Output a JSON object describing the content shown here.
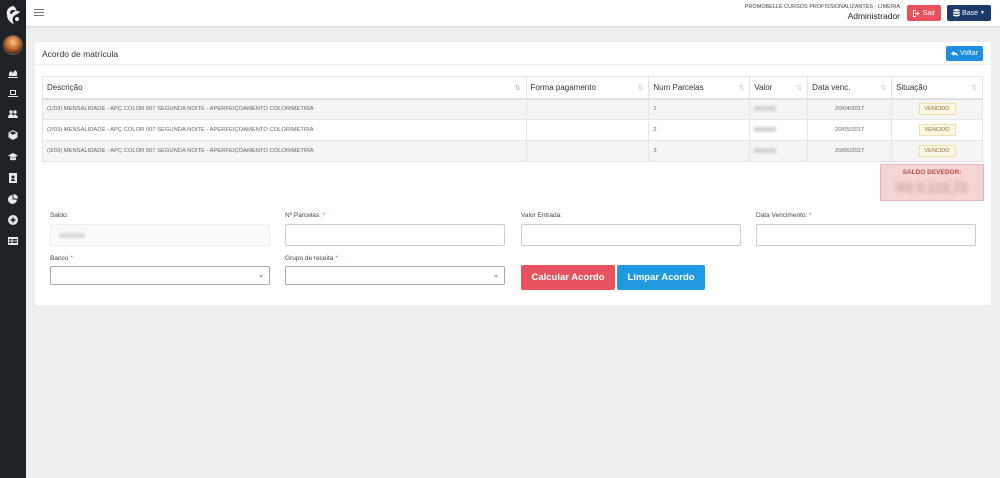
{
  "topbar": {
    "company": "PROMOBELLE CURSOS PROFISSIONALIZANTES - LIMEIRA",
    "role": "Administrador",
    "sair_label": "Sair",
    "base_label": "Base"
  },
  "panel": {
    "title": "Acordo de matrícula",
    "voltar_label": "Voltar"
  },
  "table": {
    "headers": [
      "Descrição",
      "Forma pagamento",
      "Num Parcelas",
      "Valor",
      "Data venc.",
      "Situação"
    ],
    "rows": [
      {
        "descricao": "(1/03) MENSALIDADE - APÇ COLOR 007 SEGUNDA NOITE - APERFEIÇOAMENTO COLORIMETRIA",
        "forma": "",
        "parcela": "1",
        "data": "20/04/2017",
        "situacao": "VENCIDO"
      },
      {
        "descricao": "(2/03) MENSALIDADE - APÇ COLOR 007 SEGUNDA NOITE - APERFEIÇOAMENTO COLORIMETRIA",
        "forma": "",
        "parcela": "2",
        "data": "20/05/2017",
        "situacao": "VENCIDO"
      },
      {
        "descricao": "(3/03) MENSALIDADE - APÇ COLOR 007 SEGUNDA NOITE - APERFEIÇOAMENTO COLORIMETRIA",
        "forma": "",
        "parcela": "3",
        "data": "20/06/2017",
        "situacao": "VENCIDO"
      }
    ]
  },
  "saldo_devedor": {
    "label": "SALDO DEVEDOR:",
    "value": "R$ 5.122,72"
  },
  "form": {
    "saldo_label": "Saldo:",
    "parcelas_label": "Nº Parcelas:",
    "valor_entrada_label": "Valor Entrada:",
    "data_vencimento_label": "Data Vencimento:",
    "banco_label": "Banco",
    "grupo_label": "Grupo de receita",
    "required_mark": "*",
    "calcular_label": "Calcular Acordo",
    "limpar_label": "Limpar Acordo"
  },
  "colors": {
    "sidebar": "#1d2226",
    "danger": "#e8505b",
    "primary": "#1e9ae0",
    "navy": "#1a3b6a"
  }
}
